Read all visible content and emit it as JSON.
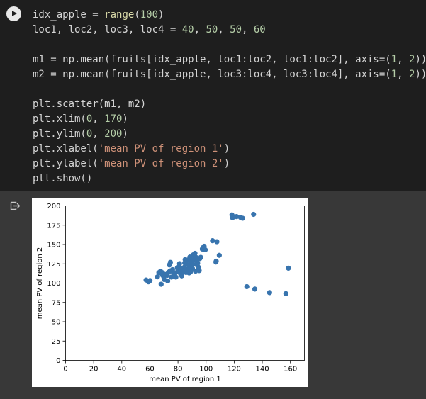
{
  "code_lines": [
    {
      "parts": [
        {
          "t": "idx_apple = ",
          "c": "plain"
        },
        {
          "t": "range",
          "c": "fn"
        },
        {
          "t": "(",
          "c": "plain"
        },
        {
          "t": "100",
          "c": "num"
        },
        {
          "t": ")",
          "c": "plain"
        }
      ]
    },
    {
      "parts": [
        {
          "t": "loc1, loc2, loc3, loc4 = ",
          "c": "plain"
        },
        {
          "t": "40",
          "c": "num"
        },
        {
          "t": ", ",
          "c": "plain"
        },
        {
          "t": "50",
          "c": "num"
        },
        {
          "t": ", ",
          "c": "plain"
        },
        {
          "t": "50",
          "c": "num"
        },
        {
          "t": ", ",
          "c": "plain"
        },
        {
          "t": "60",
          "c": "num"
        }
      ]
    },
    {
      "parts": []
    },
    {
      "parts": [
        {
          "t": "m1 = np.mean(fruits[idx_apple, loc1:loc2, loc1:loc2], axis=(",
          "c": "plain"
        },
        {
          "t": "1",
          "c": "num"
        },
        {
          "t": ", ",
          "c": "plain"
        },
        {
          "t": "2",
          "c": "num"
        },
        {
          "t": "))",
          "c": "plain"
        }
      ]
    },
    {
      "parts": [
        {
          "t": "m2 = np.mean(fruits[idx_apple, loc3:loc4, loc3:loc4], axis=(",
          "c": "plain"
        },
        {
          "t": "1",
          "c": "num"
        },
        {
          "t": ", ",
          "c": "plain"
        },
        {
          "t": "2",
          "c": "num"
        },
        {
          "t": "))",
          "c": "plain"
        }
      ]
    },
    {
      "parts": []
    },
    {
      "parts": [
        {
          "t": "plt.scatter(m1, m2)",
          "c": "plain"
        }
      ]
    },
    {
      "parts": [
        {
          "t": "plt.xlim(",
          "c": "plain"
        },
        {
          "t": "0",
          "c": "num"
        },
        {
          "t": ", ",
          "c": "plain"
        },
        {
          "t": "170",
          "c": "num"
        },
        {
          "t": ")",
          "c": "plain"
        }
      ]
    },
    {
      "parts": [
        {
          "t": "plt.ylim(",
          "c": "plain"
        },
        {
          "t": "0",
          "c": "num"
        },
        {
          "t": ", ",
          "c": "plain"
        },
        {
          "t": "200",
          "c": "num"
        },
        {
          "t": ")",
          "c": "plain"
        }
      ]
    },
    {
      "parts": [
        {
          "t": "plt.xlabel(",
          "c": "plain"
        },
        {
          "t": "'mean PV of region 1'",
          "c": "str"
        },
        {
          "t": ")",
          "c": "plain"
        }
      ]
    },
    {
      "parts": [
        {
          "t": "plt.ylabel(",
          "c": "plain"
        },
        {
          "t": "'mean PV of region 2'",
          "c": "str"
        },
        {
          "t": ")",
          "c": "plain"
        }
      ]
    },
    {
      "parts": [
        {
          "t": "plt.show()",
          "c": "plain"
        }
      ]
    }
  ],
  "icons": {
    "run": "play-icon",
    "output": "output-redirect-icon"
  },
  "colors": {
    "code_background": "#1e1e1e",
    "output_background": "#383838",
    "point": "#3874ae"
  },
  "chart_data": {
    "type": "scatter",
    "title": "",
    "xlabel": "mean PV of region 1",
    "ylabel": "mean PV of region 2",
    "xlim": [
      0,
      170
    ],
    "ylim": [
      0,
      200
    ],
    "xticks": [
      "0",
      "20",
      "40",
      "60",
      "80",
      "100",
      "120",
      "140",
      "160"
    ],
    "yticks": [
      "0",
      "25",
      "50",
      "75",
      "100",
      "125",
      "150",
      "175",
      "200"
    ],
    "grid": false,
    "points": [
      {
        "x": 57.3,
        "y": 104.0
      },
      {
        "x": 59.0,
        "y": 101.7
      },
      {
        "x": 65.4,
        "y": 108.1
      },
      {
        "x": 67.6,
        "y": 115.3
      },
      {
        "x": 68.0,
        "y": 98.5
      },
      {
        "x": 69.0,
        "y": 113.4
      },
      {
        "x": 69.8,
        "y": 108.2
      },
      {
        "x": 71.1,
        "y": 111.2
      },
      {
        "x": 72.7,
        "y": 102.8
      },
      {
        "x": 73.2,
        "y": 113.9
      },
      {
        "x": 73.9,
        "y": 123.6
      },
      {
        "x": 74.6,
        "y": 126.9
      },
      {
        "x": 75.3,
        "y": 107.8
      },
      {
        "x": 76.6,
        "y": 114.0
      },
      {
        "x": 77.4,
        "y": 111.7
      },
      {
        "x": 78.5,
        "y": 107.8
      },
      {
        "x": 80.0,
        "y": 116.4
      },
      {
        "x": 80.9,
        "y": 121.6
      },
      {
        "x": 81.3,
        "y": 113.7
      },
      {
        "x": 82.0,
        "y": 111.4
      },
      {
        "x": 82.7,
        "y": 109.4
      },
      {
        "x": 83.5,
        "y": 116.9
      },
      {
        "x": 84.4,
        "y": 120.4
      },
      {
        "x": 85.1,
        "y": 130.5
      },
      {
        "x": 85.7,
        "y": 113.8
      },
      {
        "x": 86.4,
        "y": 117.5
      },
      {
        "x": 87.3,
        "y": 123.6
      },
      {
        "x": 88.1,
        "y": 120.6
      },
      {
        "x": 88.9,
        "y": 114.4
      },
      {
        "x": 89.8,
        "y": 121.7
      },
      {
        "x": 90.6,
        "y": 124.5
      },
      {
        "x": 91.4,
        "y": 130.9
      },
      {
        "x": 92.1,
        "y": 138.6
      },
      {
        "x": 92.9,
        "y": 133.3
      },
      {
        "x": 93.6,
        "y": 127.4
      },
      {
        "x": 94.5,
        "y": 120.7
      },
      {
        "x": 95.5,
        "y": 131.8
      },
      {
        "x": 97.3,
        "y": 144.1
      },
      {
        "x": 98.6,
        "y": 147.7
      },
      {
        "x": 99.4,
        "y": 143.2
      },
      {
        "x": 104.6,
        "y": 154.9
      },
      {
        "x": 107.2,
        "y": 128.5
      },
      {
        "x": 107.7,
        "y": 153.6
      },
      {
        "x": 109.4,
        "y": 136.0
      },
      {
        "x": 118.4,
        "y": 188.3
      },
      {
        "x": 118.8,
        "y": 184.7
      },
      {
        "x": 119.5,
        "y": 185.9
      },
      {
        "x": 121.7,
        "y": 186.1
      },
      {
        "x": 124.6,
        "y": 185.0
      },
      {
        "x": 126.0,
        "y": 184.0
      },
      {
        "x": 129.0,
        "y": 95.4
      },
      {
        "x": 133.8,
        "y": 189.0
      },
      {
        "x": 134.7,
        "y": 92.3
      },
      {
        "x": 145.2,
        "y": 87.7
      },
      {
        "x": 156.8,
        "y": 86.4
      },
      {
        "x": 158.6,
        "y": 119.4
      },
      {
        "x": 60.1,
        "y": 103.3
      },
      {
        "x": 66.4,
        "y": 113.6
      },
      {
        "x": 70.2,
        "y": 104.6
      },
      {
        "x": 74.3,
        "y": 115.8
      },
      {
        "x": 76.1,
        "y": 117.5
      },
      {
        "x": 79.5,
        "y": 119.7
      },
      {
        "x": 81.1,
        "y": 125.2
      },
      {
        "x": 83.0,
        "y": 113.2
      },
      {
        "x": 84.8,
        "y": 126.2
      },
      {
        "x": 86.0,
        "y": 124.8
      },
      {
        "x": 87.7,
        "y": 117.9
      },
      {
        "x": 89.2,
        "y": 127.8
      },
      {
        "x": 90.3,
        "y": 118.9
      },
      {
        "x": 91.8,
        "y": 135.0
      },
      {
        "x": 94.0,
        "y": 125.5
      },
      {
        "x": 96.2,
        "y": 133.4
      },
      {
        "x": 107.0,
        "y": 127.3
      },
      {
        "x": 72.3,
        "y": 110.0
      },
      {
        "x": 78.0,
        "y": 113.0
      },
      {
        "x": 82.5,
        "y": 118.5
      },
      {
        "x": 86.9,
        "y": 130.0
      },
      {
        "x": 88.5,
        "y": 133.8
      },
      {
        "x": 90.9,
        "y": 136.6
      },
      {
        "x": 93.1,
        "y": 124.0
      },
      {
        "x": 95.1,
        "y": 116.2
      },
      {
        "x": 97.8,
        "y": 146.0
      },
      {
        "x": 68.8,
        "y": 110.7
      },
      {
        "x": 76.9,
        "y": 109.2
      },
      {
        "x": 84.0,
        "y": 115.7
      },
      {
        "x": 87.9,
        "y": 113.2
      },
      {
        "x": 92.5,
        "y": 115.5
      }
    ]
  }
}
